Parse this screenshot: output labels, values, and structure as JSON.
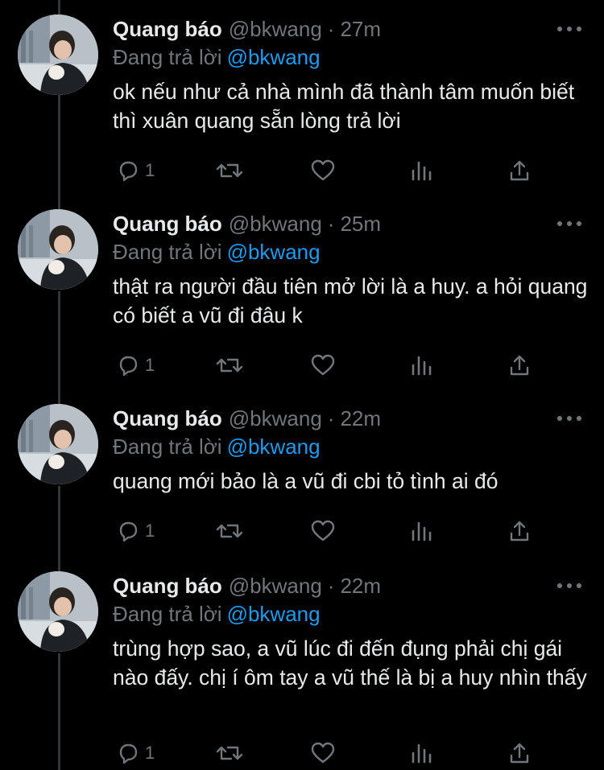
{
  "tweets": [
    {
      "display_name": "Quang báo",
      "handle": "@bkwang",
      "separator": "·",
      "time": "27m",
      "reply_prefix": "Đang trả lời",
      "reply_handle": "@bkwang",
      "text": "ok nếu như cả nhà mình đã thành tâm muốn biết thì xuân quang sẵn lòng trả lời",
      "reply_count": "1"
    },
    {
      "display_name": "Quang báo",
      "handle": "@bkwang",
      "separator": "·",
      "time": "25m",
      "reply_prefix": "Đang trả lời",
      "reply_handle": "@bkwang",
      "text": "thật ra người đầu tiên mở lời là a huy. a hỏi quang có biết a vũ đi đâu k",
      "reply_count": "1"
    },
    {
      "display_name": "Quang báo",
      "handle": "@bkwang",
      "separator": "·",
      "time": "22m",
      "reply_prefix": "Đang trả lời",
      "reply_handle": "@bkwang",
      "text": "quang mới bảo là a vũ đi cbi tỏ tình ai đó",
      "reply_count": "1"
    },
    {
      "display_name": "Quang báo",
      "handle": "@bkwang",
      "separator": "·",
      "time": "22m",
      "reply_prefix": "Đang trả lời",
      "reply_handle": "@bkwang",
      "text": "trùng hợp sao, a vũ lúc đi đến đụng phải chị gái nào đấy. chị í ôm tay a vũ thế là bị a huy nhìn thấy",
      "reply_count": "1"
    }
  ],
  "colors": {
    "background": "#000000",
    "text": "#e7e9ea",
    "muted": "#71767b",
    "accent": "#1d9bf0",
    "thread_line": "#333639"
  },
  "icons": {
    "more": "more-dots-icon",
    "reply": "reply-bubble-icon",
    "retweet": "retweet-icon",
    "like": "heart-icon",
    "views": "views-bar-chart-icon",
    "share": "share-upload-icon"
  }
}
